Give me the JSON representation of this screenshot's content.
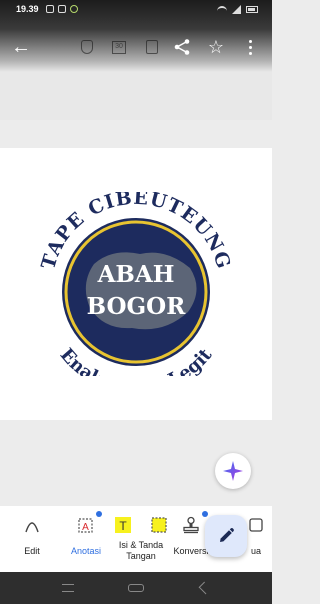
{
  "status_bar": {
    "time": "19.39"
  },
  "app_bar": {
    "icons": [
      "back-arrow-icon",
      "shield-icon",
      "calendar-icon",
      "document-icon",
      "share-icon",
      "star-icon",
      "more-vertical-icon"
    ],
    "calendar_day": "30"
  },
  "document": {
    "logo": {
      "arc_top": "TAPE CIBEUTEUNG",
      "line1": "ABAH",
      "line2": "BOGOR",
      "arc_bottom": "Enak,Manis,Legit",
      "colors": {
        "navy": "#1d2b5e",
        "gold": "#e8c431",
        "blob": "#5c6577"
      }
    }
  },
  "toolbar": {
    "tools": [
      {
        "label": "Edit",
        "icon": "edit-arch-icon"
      },
      {
        "label": "Anotasi",
        "icon": "annotation-icon",
        "active": true
      },
      {
        "label": "Isi & Tanda Tangan",
        "label_line1": "Isi & Tanda",
        "label_line2": "Tangan",
        "icon": "fill-sign-icon"
      },
      {
        "label": "Konversi",
        "icon": "stamp-icon"
      },
      {
        "label": "ua",
        "icon": "more-tools-icon"
      }
    ],
    "accent": "#2f6fe0"
  }
}
